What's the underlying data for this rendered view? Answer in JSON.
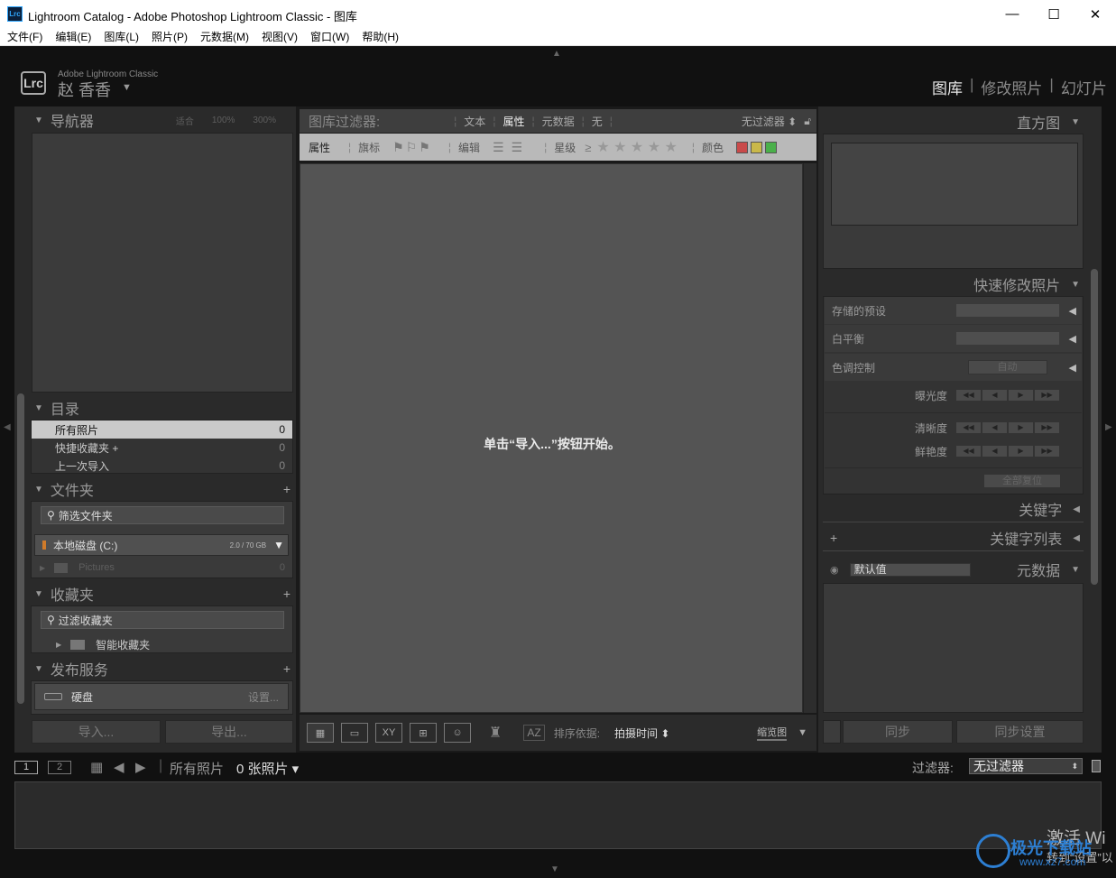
{
  "window": {
    "title": "Lightroom Catalog - Adobe Photoshop Lightroom Classic - 图库",
    "app_icon_text": "Lrc",
    "minimize": "—",
    "maximize": "☐",
    "close": "✕"
  },
  "menu": [
    "文件(F)",
    "编辑(E)",
    "图库(L)",
    "照片(P)",
    "元数据(M)",
    "视图(V)",
    "窗口(W)",
    "帮助(H)"
  ],
  "identity": {
    "badge": "Lrc",
    "product": "Adobe Lightroom Classic",
    "user": "赵 香香",
    "modules": [
      "图库",
      "修改照片",
      "幻灯片"
    ],
    "separator": "|"
  },
  "left": {
    "navigator": {
      "title": "导航器",
      "fit": "适合",
      "z100": "100%",
      "z300": "300%"
    },
    "catalog": {
      "title": "目录",
      "items": [
        {
          "label": "所有照片",
          "count": "0"
        },
        {
          "label": "快捷收藏夹 +",
          "count": "0"
        },
        {
          "label": "上一次导入",
          "count": "0"
        }
      ]
    },
    "folders": {
      "title": "文件夹",
      "filter_placeholder": "筛选文件夹",
      "volume_name": "本地磁盘 (C:)",
      "volume_size": "2.0 / 70 GB",
      "subfolder": "Pictures",
      "subfolder_count": "0"
    },
    "collections": {
      "title": "收藏夹",
      "filter_placeholder": "过滤收藏夹",
      "smart": "智能收藏夹"
    },
    "publish": {
      "title": "发布服务",
      "service": "硬盘",
      "setup": "设置..."
    },
    "import_btn": "导入...",
    "export_btn": "导出..."
  },
  "filterbar": {
    "label": "图库过滤器:",
    "tabs": [
      "文本",
      "属性",
      "元数据",
      "无"
    ],
    "preset": "无过滤器 ⬍",
    "row2": {
      "attr": "属性",
      "flag": "旗标",
      "edit": "编辑",
      "rating": "星级",
      "rating_op": "≥",
      "stars": "★ ★ ★ ★ ★",
      "color": "颜色"
    }
  },
  "center": {
    "empty_message": "单击“导入...”按钮开始。"
  },
  "toolbar": {
    "sort_label": "排序依据:",
    "sort_value": "拍摄时间 ⬍",
    "thumbs_label": "缩览图",
    "xy": "XY",
    "az": "AZ"
  },
  "right": {
    "histogram": {
      "title": "直方图"
    },
    "quick_develop": {
      "title": "快速修改照片",
      "preset_label": "存储的预设",
      "wb_label": "白平衡",
      "tone_label": "色调控制",
      "auto": "自动",
      "exposure": "曝光度",
      "clarity": "清晰度",
      "vibrance": "鲜艳度",
      "reset": "全部复位",
      "step_labels": [
        "◀◀",
        "◀",
        "▶",
        "▶▶"
      ]
    },
    "keywording": {
      "title": "关键字"
    },
    "keyword_list": {
      "title": "关键字列表"
    },
    "metadata": {
      "title": "元数据",
      "preset": "默认值"
    },
    "sync_btn": "同步",
    "sync_settings_btn": "同步设置"
  },
  "filmstrip": {
    "screen1": "1",
    "screen2": "2",
    "source": "所有照片",
    "count": "0 张照片 ▾",
    "filter_label": "过滤器:",
    "filter_value": "无过滤器"
  },
  "watermark": {
    "activate": "激活 Wi",
    "goto": "转到“设置”以",
    "site_cn": "极光下载站",
    "site": "www.xz7.com"
  }
}
